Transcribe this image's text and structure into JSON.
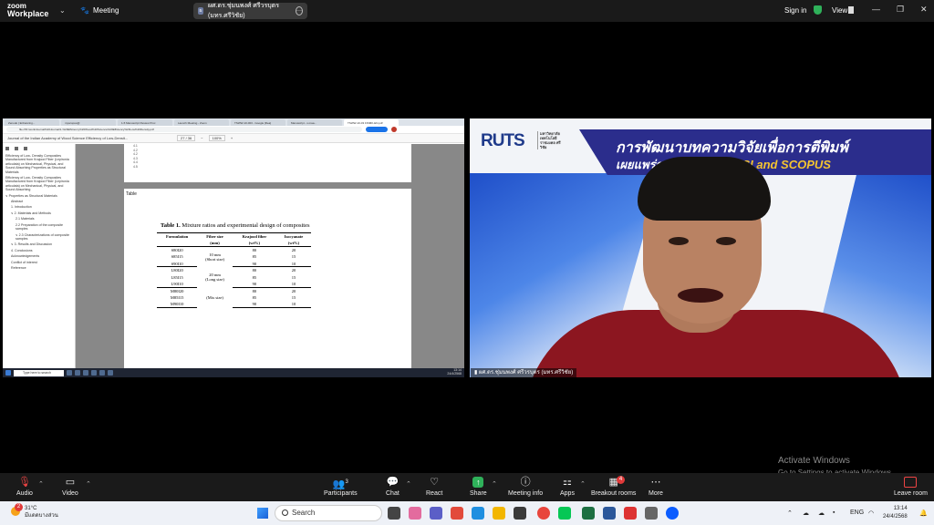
{
  "zoom": {
    "brand_line1": "zoom",
    "brand_line2": "Workplace",
    "meeting_label": "Meeting",
    "active_speaker_pill": "ผศ.ดร.ชุ่มนพงศ์ ศรีวรบุตร (มทร.ศรีวิชัย)",
    "sign_in": "Sign in",
    "view": "View",
    "toolbar": {
      "audio": "Audio",
      "video": "Video",
      "participants": "Participants",
      "participants_count": "3",
      "chat": "Chat",
      "react": "React",
      "share": "Share",
      "meeting_info": "Meeting info",
      "apps": "Apps",
      "breakout_rooms": "Breakout rooms",
      "breakout_badge": "4",
      "more": "More",
      "leave_room": "Leave room"
    }
  },
  "shared_screen": {
    "browser_tabs": [
      "Zenodo | Enhancing...",
      "myscopus@",
      "1-5 Manuscript Review Proc",
      "Launch Meeting - Zoom",
      "TSWW-10-003 - Google [Rea]",
      "Manuscript - s.maa...",
      "TSWW-10-03 FINMK-EN.pdf"
    ],
    "url": "file:///D:/work/Journal%20Journal/1-%20Efficiency%20Wood%20Science%20Efficiency%20Low%20Density.pdf",
    "pdf_title": "Journal of the Indian Academy of Wood Science  Efficiency of Low-Densit...",
    "page_current": "27",
    "page_total": "36",
    "zoom_level": "100%",
    "toc": [
      {
        "level": 0,
        "text": "Efficiency of Low- Density Composites Manufactured from Krajood Fiber (Lepironia articulata) on Mechanical, Physical, and Sound Absorbing Properties as Structural Materials"
      },
      {
        "level": 0,
        "text": "Efficiency of Low- Density Composites Manufactured from Krajood Fiber (Lepironia articulata) on Mechanical, Physical, and Sound Absorbing"
      },
      {
        "level": 0,
        "text": "∨  Properties as Structural Materials"
      },
      {
        "level": 1,
        "text": "Abstract"
      },
      {
        "level": 1,
        "text": "1. Introduction"
      },
      {
        "level": 1,
        "text": "∨  2. Materials and Methods"
      },
      {
        "level": 2,
        "text": "2.1 Materials"
      },
      {
        "level": 2,
        "text": "2.2 Preparation of the composite samples"
      },
      {
        "level": 2,
        "text": "∨  2.3 Characterizations of composite samples"
      },
      {
        "level": 1,
        "text": "∨  3. Results and Discussion"
      },
      {
        "level": 1,
        "text": "4. Conclusions"
      },
      {
        "level": 1,
        "text": "Acknowledgements"
      },
      {
        "level": 1,
        "text": "Conflict of interest"
      },
      {
        "level": 1,
        "text": "Reference"
      }
    ],
    "page1_lines": [
      "4.1",
      "4.2",
      "4.2",
      "4.3",
      "4.4",
      "4.5"
    ],
    "table_section_label": "Table",
    "table_caption_bold": "Table 1.",
    "table_caption_rest": " Mixture ratios and experimental design of composites",
    "table_headers": [
      "Formulation",
      "Fiber size",
      "Krajood fiber",
      "Isocyanate"
    ],
    "table_units": [
      "",
      "(mm)",
      "(wt%)",
      "(wt%)"
    ],
    "table_groups": [
      {
        "size_line1": "10 mm",
        "size_line2": "(Short size)",
        "rows": [
          [
            "S80I20",
            "80",
            "20"
          ],
          [
            "S85I15",
            "85",
            "15"
          ],
          [
            "S90I10",
            "90",
            "10"
          ]
        ]
      },
      {
        "size_line1": "20 mm",
        "size_line2": "(Long size)",
        "rows": [
          [
            "L80I20",
            "80",
            "20"
          ],
          [
            "L85I15",
            "85",
            "15"
          ],
          [
            "L90I10",
            "90",
            "10"
          ]
        ]
      },
      {
        "size_line1": "(Mix size)",
        "size_line2": "",
        "rows": [
          [
            "M80I20",
            "80",
            "20"
          ],
          [
            "M85I15",
            "85",
            "15"
          ],
          [
            "M90I10",
            "90",
            "10"
          ]
        ]
      }
    ],
    "taskbar_search": "Type here to search",
    "taskbar_time": "13:14",
    "taskbar_date": "24/4/2568"
  },
  "video_panel": {
    "logo_text": "RUTS",
    "logo_sub": "มหาวิทยาลัย เทคโนโลยีราชมงคล ศรีวิชัย",
    "banner_line1": "การพัฒนาบทความวิจัยเพื่อการตีพิมพ์",
    "banner_line2_prefix": "เผยแพร่ระดับนานาชาติ ",
    "banner_line2_highlight": "ISI and SCOPUS",
    "participant_name": "ผศ.ดร.ชุ่มนพงศ์ ศรีวรบุตร (มทร.ศรีวิชัย)"
  },
  "activate_windows": {
    "line1": "Activate Windows",
    "line2": "Go to Settings to activate Windows."
  },
  "windows_taskbar": {
    "temp": "31°C",
    "weather": "มีแดดบางส่วน",
    "weather_badge": "2",
    "search": "Search",
    "lang": "ENG",
    "time": "13:14",
    "date": "24/4/2568"
  }
}
